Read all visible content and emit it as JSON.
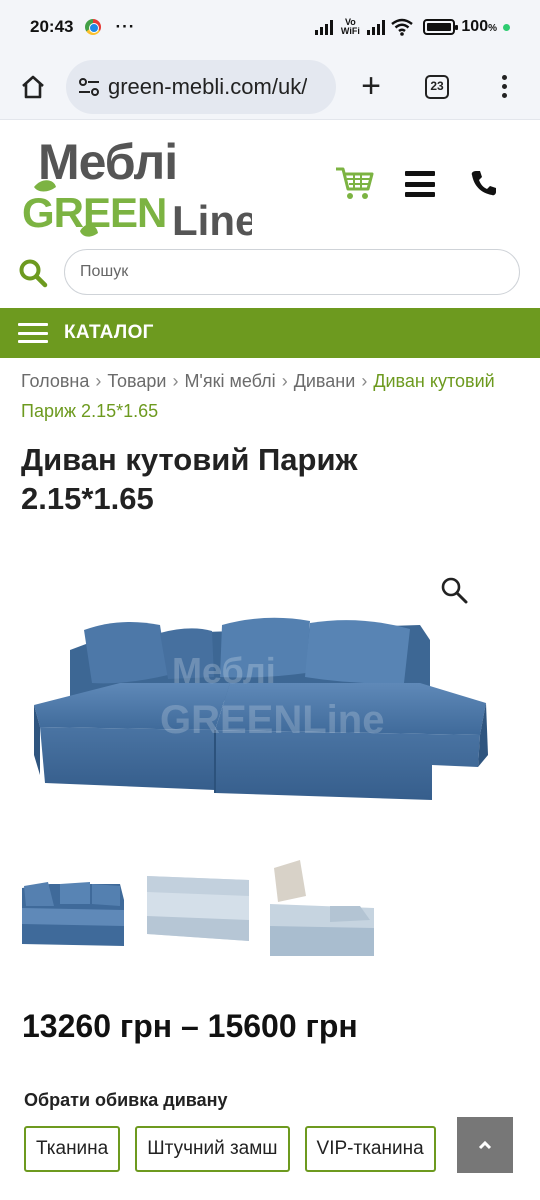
{
  "status_bar": {
    "time": "20:43",
    "dots": "···",
    "network_label": "Vo WiFi",
    "battery_percent": "100",
    "battery_unit": "%"
  },
  "browser": {
    "url": "green-mebli.com/uk/",
    "tab_count": "23",
    "new_tab_symbol": "+"
  },
  "header": {
    "logo_top": "Меблі",
    "logo_bottom_green": "GREEN",
    "logo_bottom_dark": "Line",
    "icons": [
      "cart-icon",
      "hamburger-icon",
      "phone-icon"
    ]
  },
  "search": {
    "placeholder": "Пошук"
  },
  "catalog": {
    "label": "КАТАЛОГ"
  },
  "breadcrumb": {
    "items": [
      "Головна",
      "Товари",
      "М'які меблі",
      "Дивани"
    ],
    "current": "Диван кутовий Париж 2.15*1.65"
  },
  "product": {
    "title": "Диван кутовий Париж 2.15*1.65",
    "price": "13260 грн – 15600 грн",
    "option_label": "Обрати обивка дивану",
    "options": [
      "Тканина",
      "Штучний замш",
      "VIP-тканина"
    ],
    "watermark_top": "Меблі",
    "watermark_bottom": "GREENLine"
  },
  "colors": {
    "brand_green": "#6d9a1f",
    "sofa_blue": "#4e78a8"
  }
}
